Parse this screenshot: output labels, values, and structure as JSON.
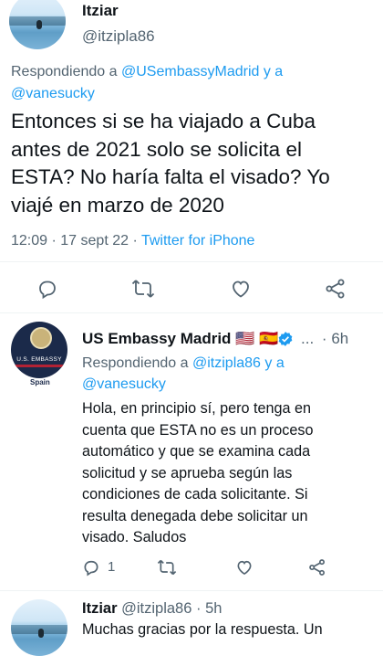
{
  "main_tweet": {
    "author_name": "Itziar",
    "handle": "@itzipla86",
    "replying_prefix": "Respondiendo a",
    "replying_to_1": "@USembassyMadrid",
    "replying_and": "y a",
    "replying_to_2": "@vanesucky",
    "text_lines": [
      "Entonces si se ha viajado a Cuba",
      "antes de 2021 solo se solicita el",
      "ESTA? No haría falta el visado? Yo",
      "viajé en marzo de 2020"
    ],
    "time": "12:09",
    "date": "17 sept 22",
    "source": "Twitter for iPhone",
    "sep": "·"
  },
  "reply1": {
    "author_name": "US Embassy Madrid",
    "flags": [
      "🇺🇸",
      "🇪🇸"
    ],
    "ellipsis": "...",
    "time": "6h",
    "sep": "·",
    "avatar_line1": "U.S. EMBASSY",
    "avatar_line2": "Spain",
    "replying_prefix": "Respondiendo a",
    "replying_to_1": "@itzipla86",
    "replying_and": "y a",
    "replying_to_2": "@vanesucky",
    "text_lines": [
      "Hola, en principio sí, pero  tenga en",
      "cuenta que ESTA no es un proceso",
      "automático y que se examina cada",
      "solicitud y se aprueba según las",
      "condiciones de cada solicitante. Si",
      "resulta denegada debe solicitar un",
      "visado. Saludos"
    ],
    "reply_count": "1"
  },
  "reply2": {
    "author_name": "Itziar",
    "handle": "@itzipla86",
    "sep": "·",
    "time": "5h",
    "text_start": "Muchas gracias por la respuesta. Un"
  },
  "colors": {
    "link": "#1d9bf0",
    "muted": "#536471",
    "verified": "#1d9bf0",
    "embassy_navy": "#1b2a4a"
  },
  "icons": [
    "reply-icon",
    "retweet-icon",
    "like-icon",
    "share-icon",
    "verified-badge-icon",
    "more-icon"
  ]
}
